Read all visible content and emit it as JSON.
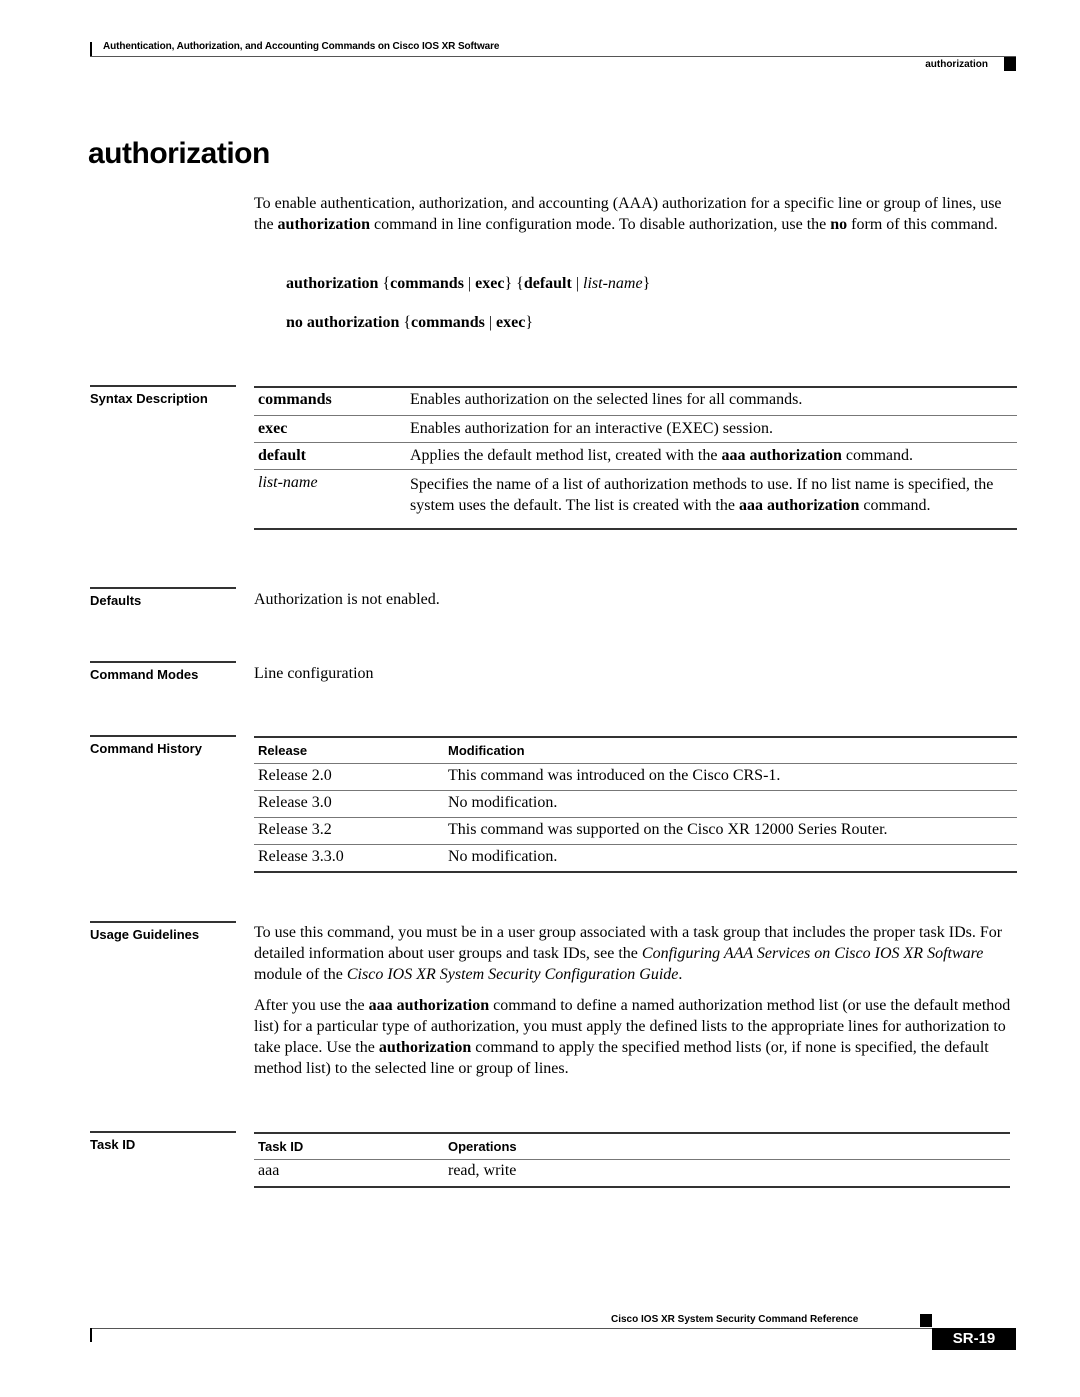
{
  "header": {
    "chapter_title": "Authentication, Authorization, and Accounting Commands on Cisco IOS XR Software",
    "running_head": "authorization"
  },
  "page_title": "authorization",
  "intro": {
    "p1": "To enable authentication, authorization, and accounting (AAA) authorization for a specific line or group of lines, use the ",
    "cmd": "authorization",
    "p2": " command in line configuration mode. To disable authorization, use the ",
    "no": "no",
    "p3": " form of this command."
  },
  "syntax": {
    "line1": {
      "kw": "authorization",
      "brace_open": " {",
      "opt1": "commands",
      "sep": " | ",
      "opt2": "exec",
      "brace_close": "}",
      "brace_open2": " {",
      "opt3": "default",
      "sep2": " | ",
      "arg": "list-name",
      "brace_close2": "}"
    },
    "line2": {
      "kw": "no authorization",
      "brace_open": " {",
      "opt1": "commands",
      "sep": " | ",
      "opt2": "exec",
      "brace_close": "}"
    }
  },
  "sections": {
    "syntax_description": "Syntax Description",
    "defaults": "Defaults",
    "command_modes": "Command Modes",
    "command_history": "Command History",
    "usage_guidelines": "Usage Guidelines",
    "task_id": "Task ID"
  },
  "syntax_table": [
    {
      "term": "commands",
      "desc": "Enables authorization on the selected lines for all commands."
    },
    {
      "term": "exec",
      "desc": "Enables authorization for an interactive (EXEC) session."
    },
    {
      "term": "default",
      "desc_a": "Applies the default method list, created with the ",
      "desc_b": "aaa authorization",
      "desc_c": " command."
    },
    {
      "term": "list-name",
      "desc_a": "Specifies the name of a list of authorization methods to use. If no list name is specified, the system uses the default. The list is created with the ",
      "desc_b": "aaa authorization",
      "desc_c": " command."
    }
  ],
  "defaults_text": "Authorization is not enabled.",
  "command_modes_text": "Line configuration",
  "history": {
    "headers": [
      "Release",
      "Modification"
    ],
    "rows": [
      [
        "Release 2.0",
        "This command was introduced on the Cisco CRS-1."
      ],
      [
        "Release 3.0",
        "No modification."
      ],
      [
        "Release 3.2",
        "This command was supported on the Cisco XR 12000 Series Router."
      ],
      [
        "Release 3.3.0",
        "No modification."
      ]
    ]
  },
  "usage": {
    "p1a": "To use this command, you must be in a user group associated with a task group that includes the proper task IDs. For detailed information about user groups and task IDs, see the ",
    "p1b": "Configuring AAA Services on Cisco IOS XR Software",
    "p1c": " module of the ",
    "p1d": "Cisco IOS XR System Security Configuration Guide",
    "p1e": ".",
    "p2a": "After you use the ",
    "p2b": "aaa authorization",
    "p2c": " command to define a named authorization method list (or use the default method list) for a particular type of authorization, you must apply the defined lists to the appropriate lines for authorization to take place. Use the ",
    "p2d": "authorization",
    "p2e": " command to apply the specified method lists (or, if none is specified, the default method list) to the selected line or group of lines."
  },
  "task_table": {
    "headers": [
      "Task ID",
      "Operations"
    ],
    "rows": [
      [
        "aaa",
        "read, write"
      ]
    ]
  },
  "footer": {
    "book_title": "Cisco IOS XR System Security Command Reference",
    "page_number": "SR-19"
  }
}
